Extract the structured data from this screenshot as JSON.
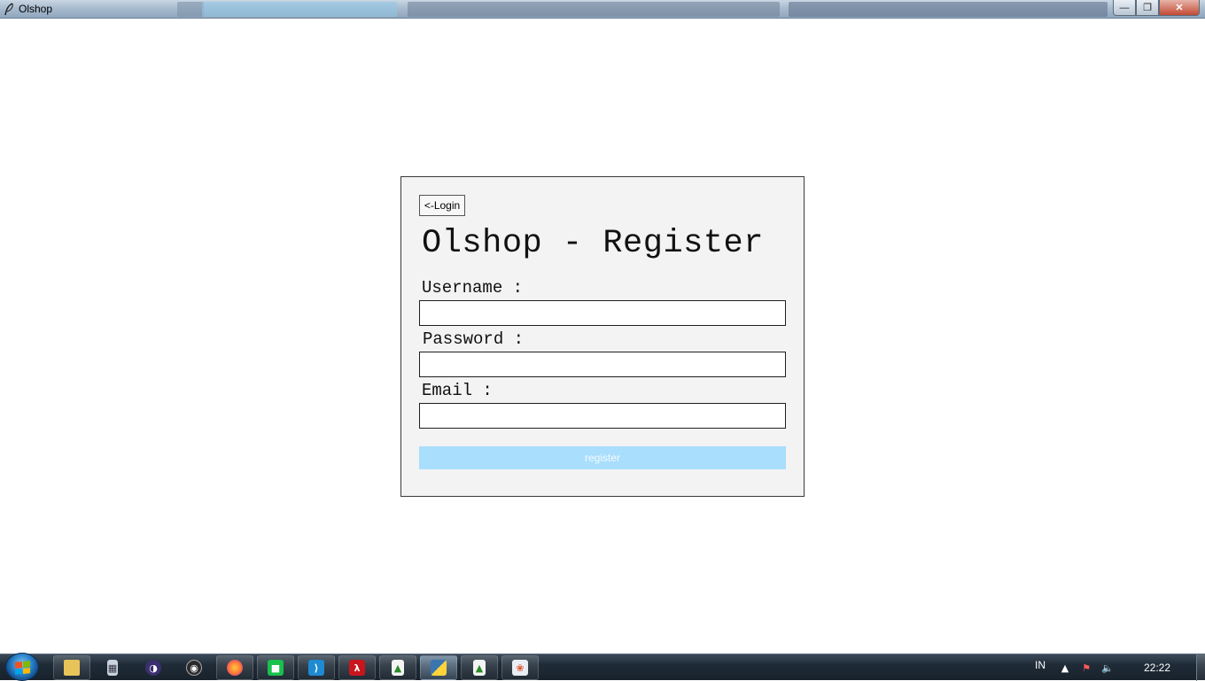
{
  "window": {
    "title": "Olshop"
  },
  "register_form": {
    "back_label": "<-Login",
    "heading": "Olshop - Register",
    "username_label": "Username :",
    "password_label": "Password :",
    "email_label": "Email :",
    "username_value": "",
    "password_value": "",
    "email_value": "",
    "register_label": "register"
  },
  "taskbar": {
    "items": [
      {
        "name": "file-explorer",
        "icon": "folder-icon"
      },
      {
        "name": "calculator",
        "icon": "calculator-icon"
      },
      {
        "name": "eclipse",
        "icon": "eclipse-icon"
      },
      {
        "name": "obs",
        "icon": "obs-icon"
      },
      {
        "name": "firefox",
        "icon": "firefox-icon"
      },
      {
        "name": "line",
        "icon": "chat-icon"
      },
      {
        "name": "vscode",
        "icon": "vscode-icon"
      },
      {
        "name": "acrobat",
        "icon": "pdf-icon"
      },
      {
        "name": "app-feather",
        "icon": "feather-icon"
      },
      {
        "name": "python",
        "icon": "python-icon"
      },
      {
        "name": "app-feather-2",
        "icon": "feather-icon"
      },
      {
        "name": "paint",
        "icon": "paint-icon"
      }
    ],
    "tray": {
      "language": "IN",
      "time": "22:22"
    }
  },
  "colors": {
    "card_background": "#f3f3f3",
    "register_button": "#a9defc",
    "register_text": "#f4fbff"
  }
}
